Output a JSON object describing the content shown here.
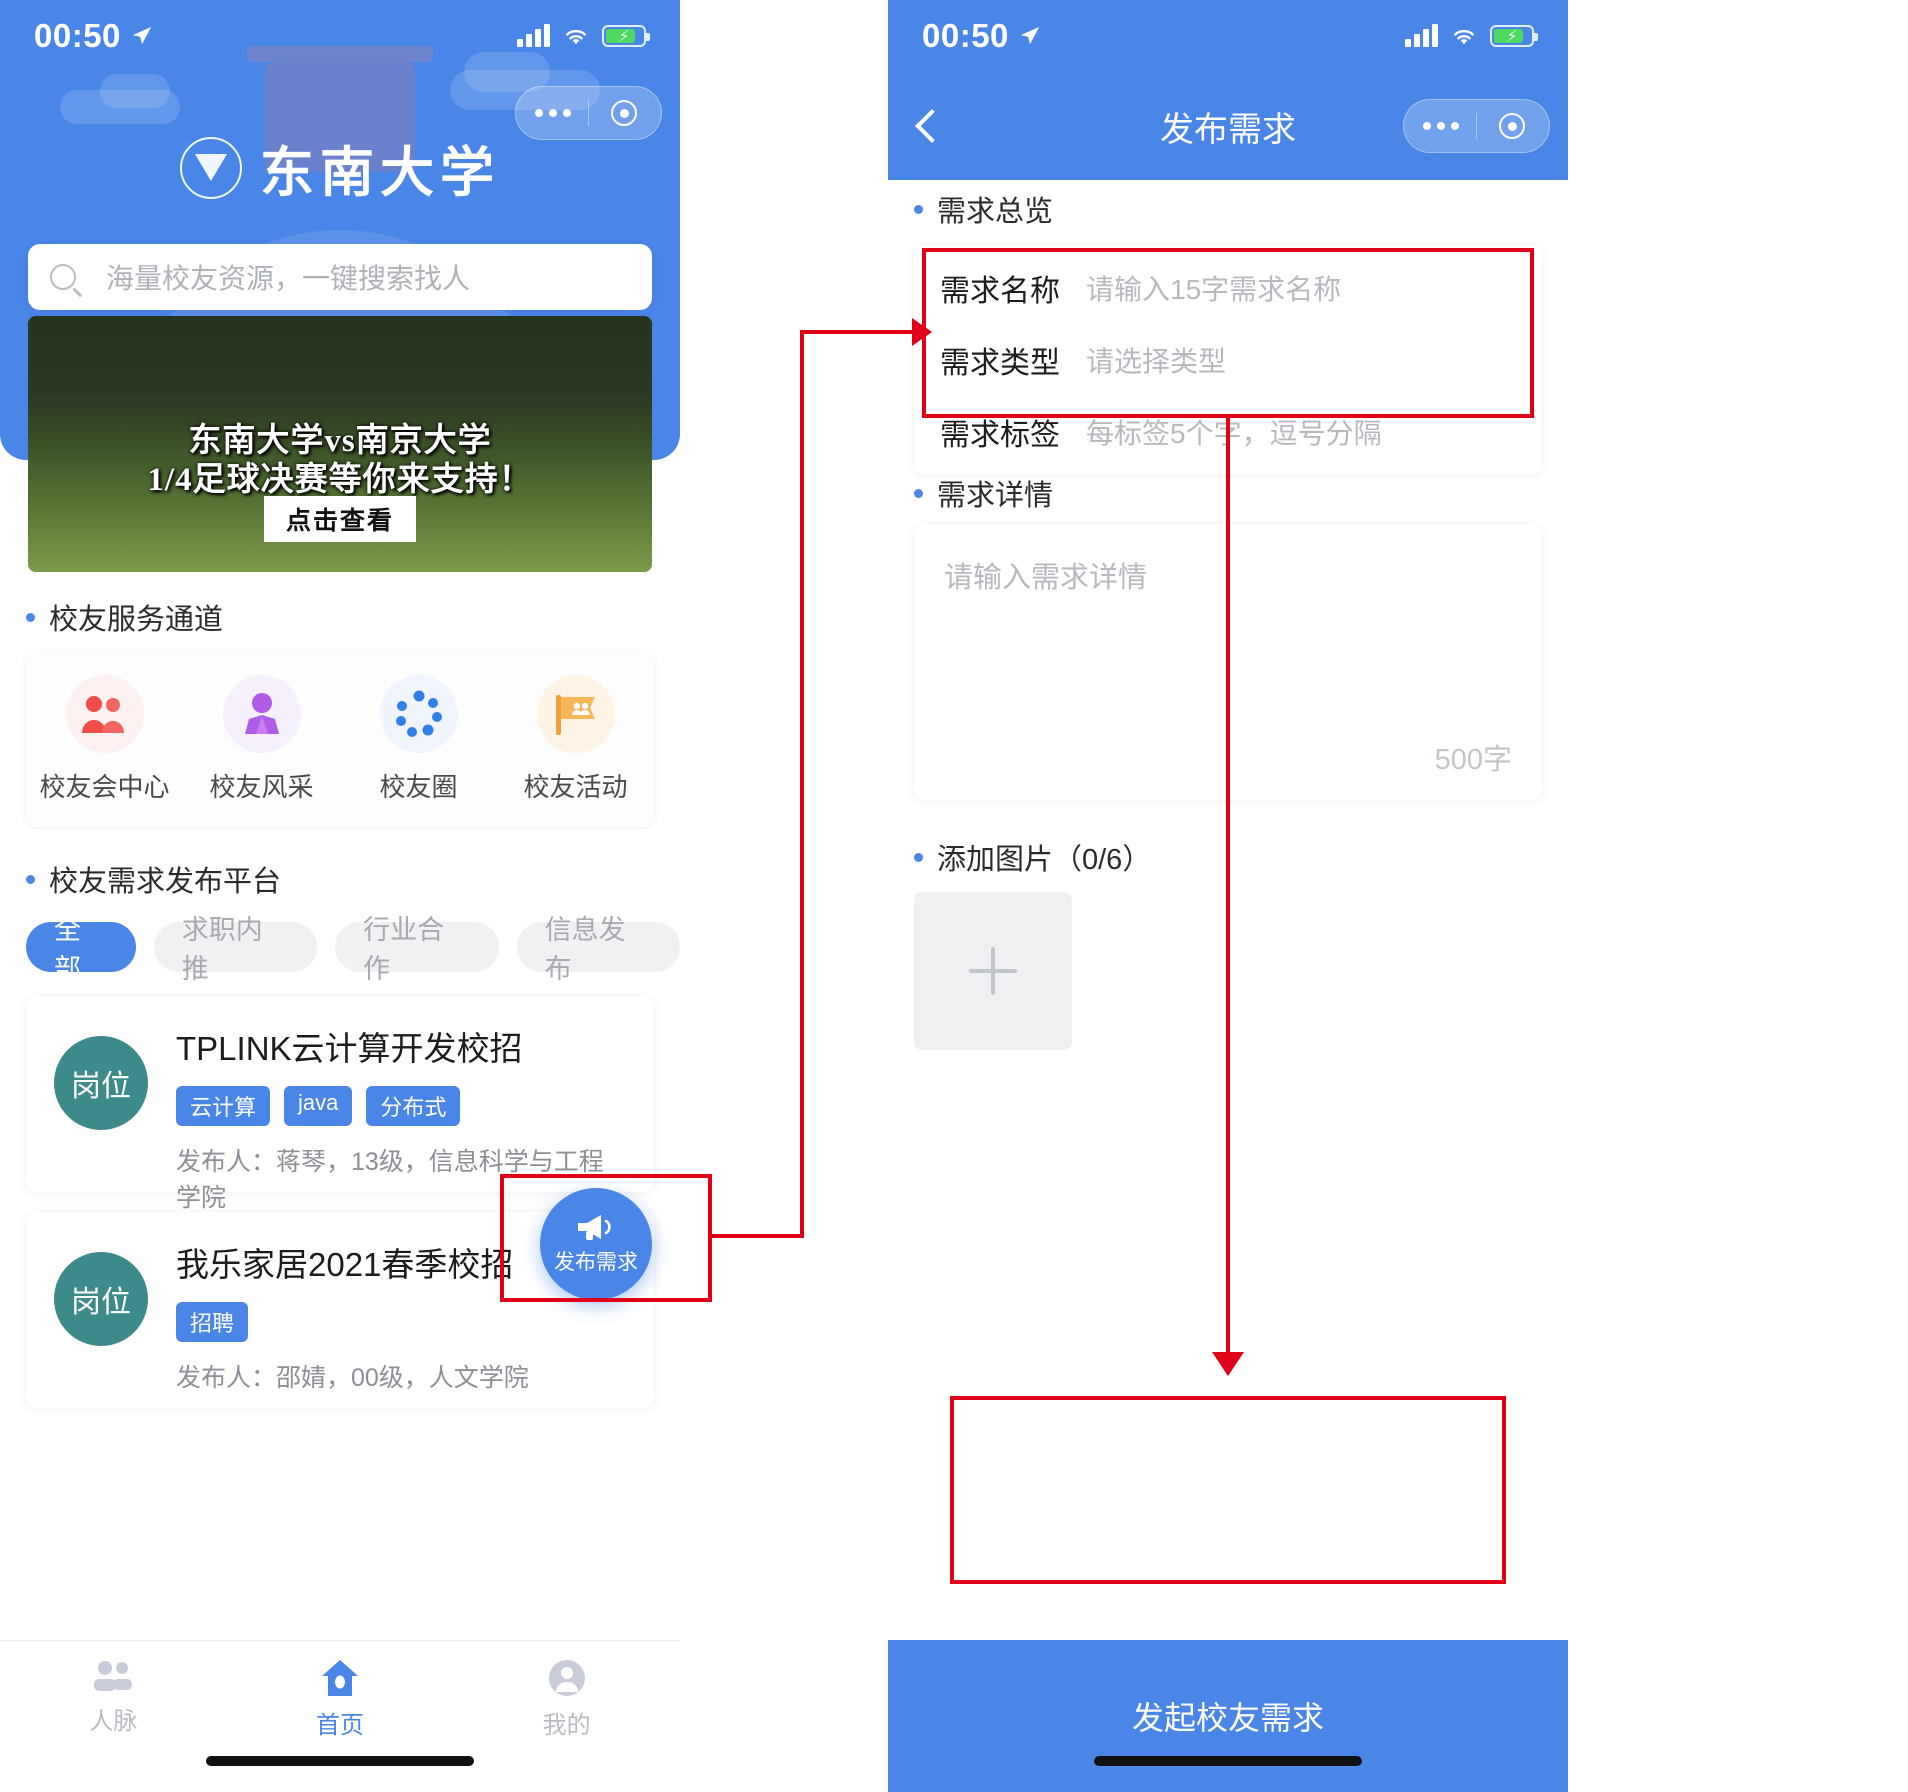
{
  "left": {
    "status": {
      "time": "00:50",
      "location_icon": "location-arrow-icon",
      "signal_icon": "signal-bars-icon",
      "wifi_icon": "wifi-icon",
      "battery_icon": "battery-charging-icon"
    },
    "capsule": {
      "more_icon": "more-dots-icon",
      "target_icon": "target-circle-icon"
    },
    "brand": {
      "crest_icon": "seu-crest-icon",
      "name": "东南大学"
    },
    "search": {
      "icon": "search-icon",
      "placeholder": "海量校友资源，一键搜索找人"
    },
    "banner": {
      "line1": "东南大学vs南京大学",
      "line2": "1/4足球决赛等你来支持！",
      "cta": "点击查看"
    },
    "service_section": {
      "title": "校友服务通道",
      "items": [
        {
          "label": "校友会中心",
          "icon": "people-group-icon",
          "color": "#e8443c"
        },
        {
          "label": "校友风采",
          "icon": "person-suit-icon",
          "color": "#a855e8"
        },
        {
          "label": "校友圈",
          "icon": "dotted-circle-icon",
          "color": "#2f7fe8"
        },
        {
          "label": "校友活动",
          "icon": "flag-people-icon",
          "color": "#f2a43a"
        }
      ]
    },
    "platform_section": {
      "title": "校友需求发布平台",
      "tabs": [
        {
          "label": "全部",
          "active": true
        },
        {
          "label": "求职内推",
          "active": false
        },
        {
          "label": "行业合作",
          "active": false
        },
        {
          "label": "信息发布",
          "active": false
        }
      ],
      "cards": [
        {
          "badge": "岗位",
          "title": "TPLINK云计算开发校招",
          "tags": [
            "云计算",
            "java",
            "分布式"
          ],
          "meta": "发布人：蒋琴，13级，信息科学与工程学院"
        },
        {
          "badge": "岗位",
          "title": "我乐家居2021春季校招",
          "tags": [
            "招聘"
          ],
          "meta": "发布人：邵婧，00级，人文学院"
        }
      ]
    },
    "fab": {
      "label": "发布需求",
      "icon": "megaphone-icon",
      "color": "#4a86e8"
    },
    "tabbar": [
      {
        "label": "人脉",
        "icon": "contacts-icon",
        "active": false
      },
      {
        "label": "首页",
        "icon": "home-icon",
        "active": true
      },
      {
        "label": "我的",
        "icon": "user-icon",
        "active": false
      }
    ]
  },
  "right": {
    "status": {
      "time": "00:50",
      "location_icon": "location-arrow-icon",
      "signal_icon": "signal-bars-icon",
      "wifi_icon": "wifi-icon",
      "battery_icon": "battery-charging-icon"
    },
    "nav": {
      "back_icon": "chevron-left-icon",
      "title": "发布需求",
      "more_icon": "more-dots-icon",
      "target_icon": "target-circle-icon"
    },
    "overview_section": {
      "title": "需求总览",
      "fields": [
        {
          "label": "需求名称",
          "placeholder": "请输入15字需求名称",
          "value": ""
        },
        {
          "label": "需求类型",
          "placeholder": "请选择类型",
          "value": ""
        },
        {
          "label": "需求标签",
          "placeholder": "每标签5个字，逗号分隔",
          "value": ""
        }
      ]
    },
    "detail_section": {
      "title": "需求详情",
      "placeholder": "请输入需求详情",
      "value": "",
      "counter": "500字"
    },
    "images_section": {
      "title": "添加图片（0/6）",
      "add_icon": "plus-icon"
    },
    "submit": {
      "label": "发起校友需求"
    }
  },
  "annotations": {
    "accent_color": "#e00018",
    "boxes": [
      "fab-highlight",
      "form-fields-highlight",
      "submit-highlight"
    ],
    "arrows": [
      "fab-to-form-arrow",
      "form-to-submit-arrow"
    ]
  }
}
